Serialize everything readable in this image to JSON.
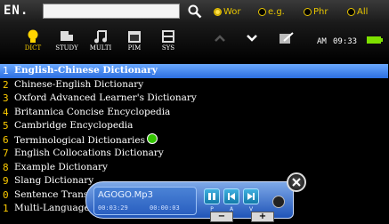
{
  "search": {
    "lang": "EN.",
    "value": "",
    "placeholder": ""
  },
  "search_modes": [
    {
      "label": "Wor",
      "selected": true
    },
    {
      "label": "e.g.",
      "selected": false
    },
    {
      "label": "Phr",
      "selected": false
    },
    {
      "label": "All",
      "selected": false
    }
  ],
  "toolbar": {
    "tabs": [
      {
        "label": "DICT",
        "icon": "bulb-icon",
        "active": true
      },
      {
        "label": "STUDY",
        "icon": "study-icon",
        "active": false
      },
      {
        "label": "MULTI",
        "icon": "music-note-icon",
        "active": false
      },
      {
        "label": "PIM",
        "icon": "calendar-icon",
        "active": false
      },
      {
        "label": "SYS",
        "icon": "settings-box-icon",
        "active": false
      }
    ]
  },
  "status": {
    "ampm": "AM",
    "time": "09:33",
    "battery": "battery-icon"
  },
  "list": {
    "items": [
      {
        "num": "1",
        "label": "English-Chinese Dictionary"
      },
      {
        "num": "2",
        "label": "Chinese-English Dictionary"
      },
      {
        "num": "3",
        "label": "Oxford Advanced Learner's Dictionary"
      },
      {
        "num": "4",
        "label": "Britannica Concise Encyclopedia"
      },
      {
        "num": "5",
        "label": "Cambridge Encyclopedia"
      },
      {
        "num": "6",
        "label": "Terminological Dictionaries"
      },
      {
        "num": "7",
        "label": "English Collocations Dictionary"
      },
      {
        "num": "8",
        "label": "Example Dictionary"
      },
      {
        "num": "9",
        "label": "Slang Dictionary"
      },
      {
        "num": "0",
        "label": "Sentence Translation"
      },
      {
        "num": "1",
        "label": "Multi-Language"
      }
    ],
    "selected_index": 0
  },
  "player": {
    "track": "AGOGO.Mp3",
    "current_time": "00:03:29",
    "total_time": "00:00:03",
    "buttons": [
      {
        "label": "P",
        "icon": "pause-icon"
      },
      {
        "label": "A",
        "icon": "skip-back-icon"
      },
      {
        "label": "V",
        "icon": "skip-forward-icon"
      }
    ],
    "vol_down": "−",
    "vol_up": "+"
  },
  "colors": {
    "accent": "#ffcc00",
    "selection": "#3c7fe8",
    "player": "#2a64c8"
  }
}
